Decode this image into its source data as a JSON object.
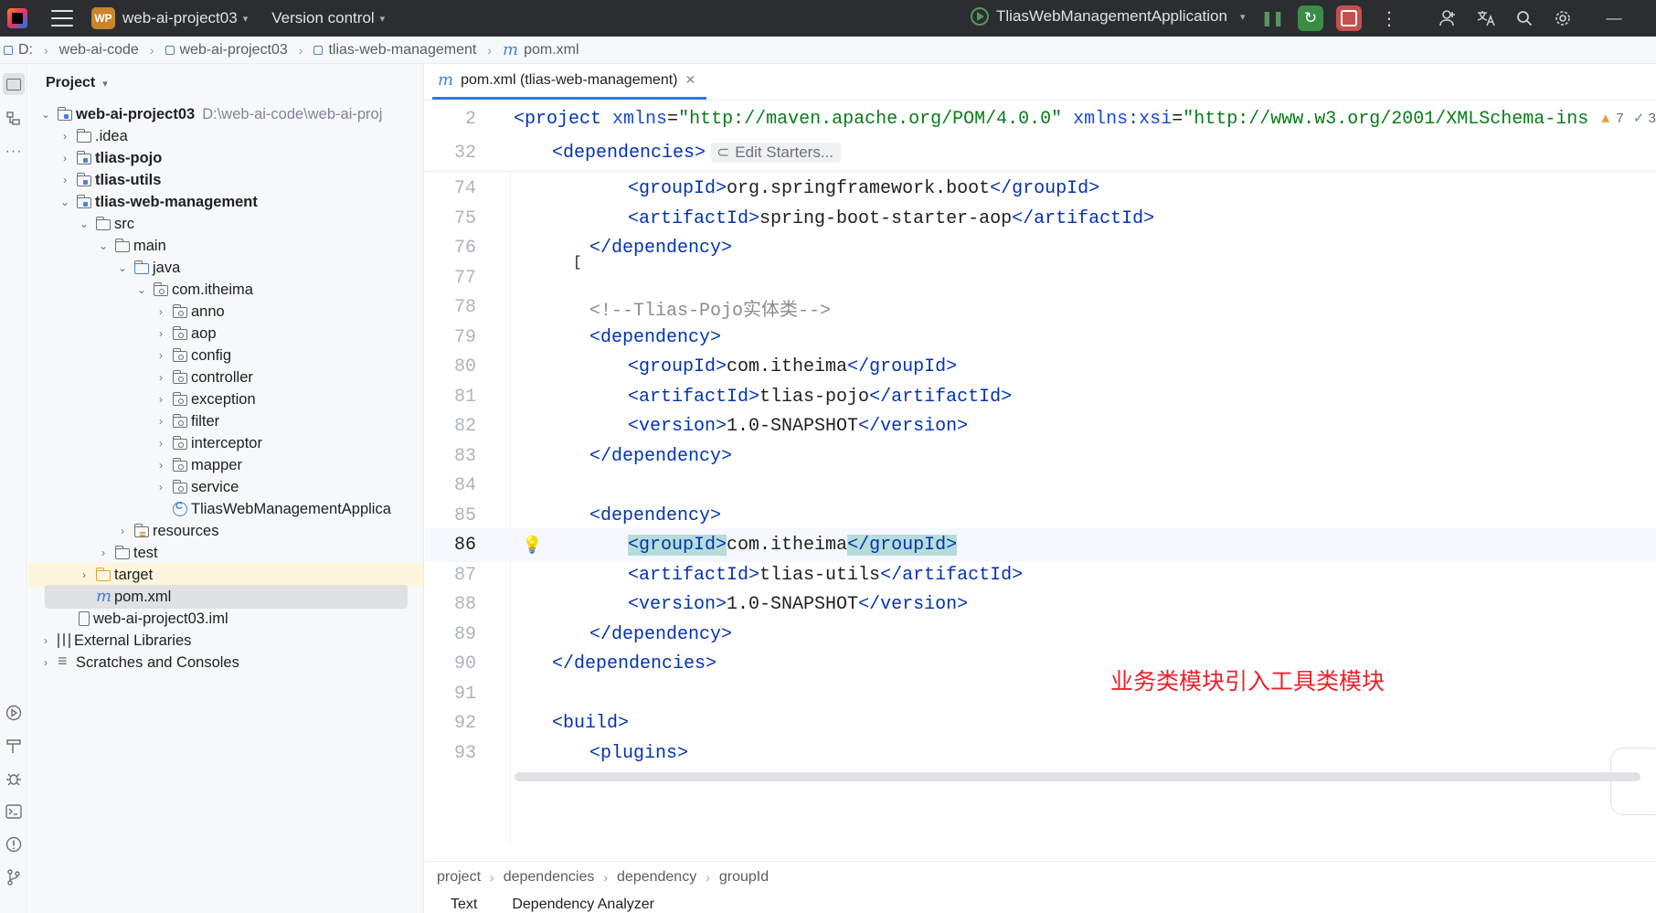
{
  "titlebar": {
    "project_badge": "WP",
    "project_name": "web-ai-project03",
    "version_control": "Version control",
    "run_config": "TliasWebManagementApplication"
  },
  "breadcrumb": {
    "drive": "D:",
    "items": [
      "web-ai-code",
      "web-ai-project03",
      "tlias-web-management",
      "pom.xml"
    ]
  },
  "project_panel": {
    "title": "Project",
    "tree": [
      {
        "label": "web-ai-project03",
        "path": "D:\\web-ai-code\\web-ai-proj"
      },
      {
        "label": ".idea"
      },
      {
        "label": "tlias-pojo"
      },
      {
        "label": "tlias-utils"
      },
      {
        "label": "tlias-web-management"
      },
      {
        "label": "src"
      },
      {
        "label": "main"
      },
      {
        "label": "java"
      },
      {
        "label": "com.itheima"
      },
      {
        "label": "anno"
      },
      {
        "label": "aop"
      },
      {
        "label": "config"
      },
      {
        "label": "controller"
      },
      {
        "label": "exception"
      },
      {
        "label": "filter"
      },
      {
        "label": "interceptor"
      },
      {
        "label": "mapper"
      },
      {
        "label": "service"
      },
      {
        "label": "TliasWebManagementApplica"
      },
      {
        "label": "resources"
      },
      {
        "label": "test"
      },
      {
        "label": "target"
      },
      {
        "label": "pom.xml"
      },
      {
        "label": "web-ai-project03.iml"
      },
      {
        "label": "External Libraries"
      },
      {
        "label": "Scratches and Consoles"
      }
    ]
  },
  "editor": {
    "tab_label": "pom.xml (tlias-web-management)",
    "inspection": {
      "warnings": "7",
      "ok": "3"
    },
    "edit_starters": "Edit Starters...",
    "lines": {
      "l2": "2",
      "l32": "32",
      "l74": "74",
      "l75": "75",
      "l76": "76",
      "l77": "77",
      "l78": "78",
      "l79": "79",
      "l80": "80",
      "l81": "81",
      "l82": "82",
      "l83": "83",
      "l84": "84",
      "l85": "85",
      "l86": "86",
      "l87": "87",
      "l88": "88",
      "l89": "89",
      "l90": "90",
      "l91": "91",
      "l92": "92",
      "l93": "93"
    },
    "code": {
      "project_tag": "<project",
      "xmlns_attr": "xmlns",
      "xmlns_val": "\"http://maven.apache.org/POM/4.0.0\"",
      "xsi_attr": "xmlns:xsi",
      "xsi_val": "\"http://www.w3.org/2001/XMLSchema-ins",
      "dependencies_open": "<dependencies>",
      "groupId_aop": "org.springframework.boot",
      "artifactId_aop": "spring-boot-starter-aop",
      "comment": "<!--Tlias-Pojo实体类-->",
      "groupId_pojo": "com.itheima",
      "artifactId_pojo": "tlias-pojo",
      "version_pojo": "1.0-SNAPSHOT",
      "groupId_utils": "com.itheima",
      "artifactId_utils": "tlias-utils",
      "version_utils": "1.0-SNAPSHOT",
      "build": "<build>",
      "plugins": "<plugins>"
    },
    "annotation": "业务类模块引入工具类模块"
  },
  "status_crumbs": [
    "project",
    "dependencies",
    "dependency",
    "groupId"
  ],
  "bottom_tabs": [
    "Text",
    "Dependency Analyzer"
  ]
}
